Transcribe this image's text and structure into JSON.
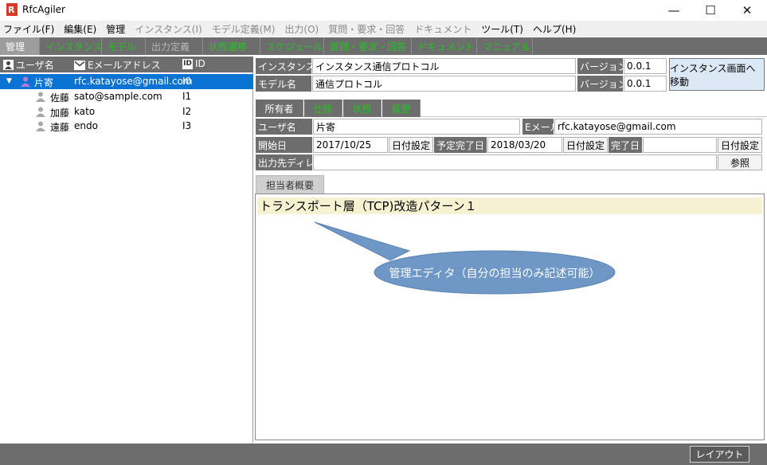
{
  "window": {
    "title": "RfcAgiler",
    "minimize_glyph": "—",
    "maximize_glyph": "☐",
    "close_glyph": "✕"
  },
  "menu": [
    {
      "label": "ファイル(F)",
      "enabled": true
    },
    {
      "label": "編集(E)",
      "enabled": true
    },
    {
      "label": "管理",
      "enabled": true
    },
    {
      "label": "インスタンス(I)",
      "enabled": false
    },
    {
      "label": "モデル定義(M)",
      "enabled": false
    },
    {
      "label": "出力(O)",
      "enabled": false
    },
    {
      "label": "質問・要求・回答",
      "enabled": false
    },
    {
      "label": "ドキュメント",
      "enabled": false
    },
    {
      "label": "ツール(T)",
      "enabled": true
    },
    {
      "label": "ヘルプ(H)",
      "enabled": true
    }
  ],
  "main_tabs": [
    {
      "label": "管理",
      "state": "active"
    },
    {
      "label": "インスタンス",
      "state": "green"
    },
    {
      "label": "モデル",
      "state": "green"
    },
    {
      "label": "出力定義",
      "state": "gray"
    },
    {
      "label": "状態遷移",
      "state": "green"
    },
    {
      "label": "スケジュール",
      "state": "green"
    },
    {
      "label": "質問・要求・回答",
      "state": "green"
    },
    {
      "label": "ドキュメント",
      "state": "green"
    },
    {
      "label": "マニュアル",
      "state": "green"
    }
  ],
  "user_table": {
    "columns": {
      "name": "ユーザ名",
      "email": "Eメールアドレス",
      "id": "ID"
    },
    "id_icon_text": "ID",
    "rows": [
      {
        "name": "片寄",
        "email": "rfc.katayose@gmail.com",
        "id": "I0",
        "selected": true,
        "expanded": true
      },
      {
        "name": "佐藤",
        "email": "sato@sample.com",
        "id": "I1",
        "selected": false
      },
      {
        "name": "加藤",
        "email": "kato",
        "id": "I2",
        "selected": false
      },
      {
        "name": "遠藤",
        "email": "endo",
        "id": "I3",
        "selected": false
      }
    ]
  },
  "instance": {
    "instance_name_label": "インスタンス名",
    "instance_name_value": "インスタンス通信プロトコル",
    "model_name_label": "モデル名",
    "model_name_value": "通信プロトコル",
    "version_label": "バージョン",
    "version_value_1": "0.0.1",
    "version_value_2": "0.0.1",
    "goto_button": "インスタンス画面へ移動"
  },
  "sub_tabs": [
    {
      "label": "所有者",
      "state": "active"
    },
    {
      "label": "仕様",
      "state": "green"
    },
    {
      "label": "状態",
      "state": "green"
    },
    {
      "label": "履歴",
      "state": "green"
    }
  ],
  "owner": {
    "user_label": "ユーザ名",
    "user_value": "片寄",
    "email_label": "Eメール",
    "email_value": "rfc.katayose@gmail.com",
    "start_label": "開始日",
    "start_value": "2017/10/25",
    "date_btn": "日付設定",
    "planned_label": "予定完了日",
    "planned_value": "2018/03/20",
    "done_label": "完了日",
    "done_value": "",
    "outdir_label": "出力先ディレクトリ",
    "outdir_value": "",
    "browse_btn": "参照"
  },
  "summary_tab": "担当者概要",
  "editor_text": "トランスポート層（TCP)改造パターン１",
  "callout_text": "管理エディタ（自分の担当のみ記述可能）",
  "status": {
    "layout_button": "レイアウト"
  },
  "colors": {
    "accent_blue": "#0a73d4",
    "green_tab": "#25c025",
    "dark_gray": "#6d6d6d",
    "callout": "#6e97c6",
    "editor_highlight": "#f7f3d2"
  }
}
